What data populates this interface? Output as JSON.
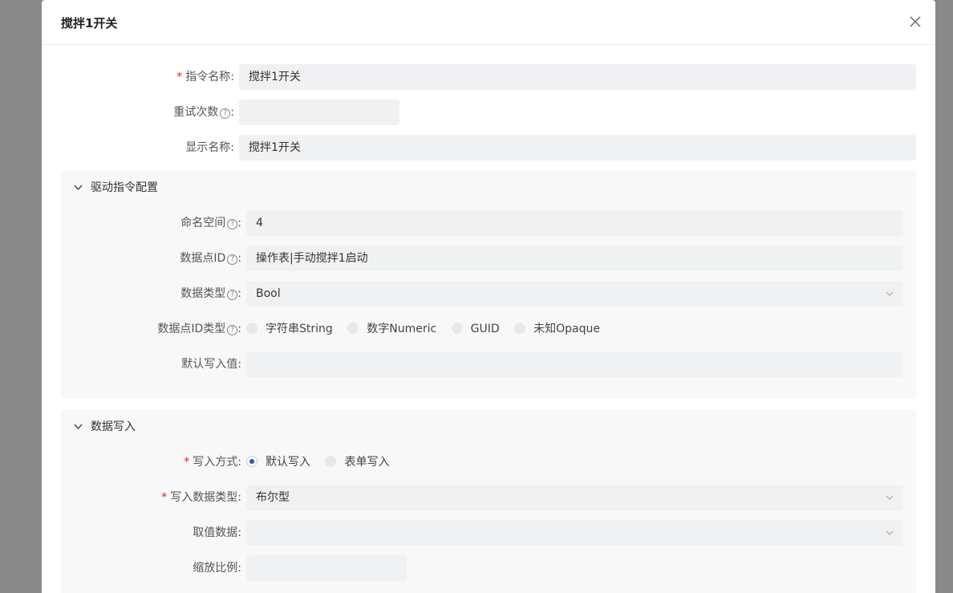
{
  "modal": {
    "title": "搅拌1开关"
  },
  "form": {
    "command_name": {
      "label": "指令名称:",
      "value": "搅拌1开关",
      "required": true
    },
    "retry_count": {
      "label": "重试次数",
      "value": ""
    },
    "display_name": {
      "label": "显示名称:",
      "value": "搅拌1开关"
    }
  },
  "driver_panel": {
    "title": "驱动指令配置",
    "namespace": {
      "label": "命名空间",
      "value": "4"
    },
    "data_point_id": {
      "label": "数据点ID",
      "value": "操作表|手动搅拌1启动"
    },
    "data_type": {
      "label": "数据类型",
      "value": "Bool"
    },
    "data_point_id_type": {
      "label": "数据点ID类型",
      "options": [
        "字符串String",
        "数字Numeric",
        "GUID",
        "未知Opaque"
      ],
      "selected": null
    },
    "default_write_value": {
      "label": "默认写入值:",
      "value": ""
    }
  },
  "write_panel": {
    "title": "数据写入",
    "write_mode": {
      "label": "写入方式:",
      "required": true,
      "options": [
        "默认写入",
        "表单写入"
      ],
      "selected": "默认写入"
    },
    "write_data_type": {
      "label": "写入数据类型:",
      "value": "布尔型",
      "required": true
    },
    "value_data": {
      "label": "取值数据:",
      "value": ""
    },
    "scale_ratio": {
      "label": "缩放比例:",
      "value": ""
    }
  },
  "colors": {
    "accent": "#3b4cc0",
    "required": "#e02020",
    "field_bg": "#f0f1f3",
    "backdrop": "#8a8a8a"
  },
  "icons": {
    "close": "close-icon",
    "help": "question-circle-icon",
    "collapse": "chevron-down-icon",
    "select": "chevron-down-icon"
  },
  "glyphs": {
    "help": "?",
    "colon": ":",
    "required": "*"
  }
}
